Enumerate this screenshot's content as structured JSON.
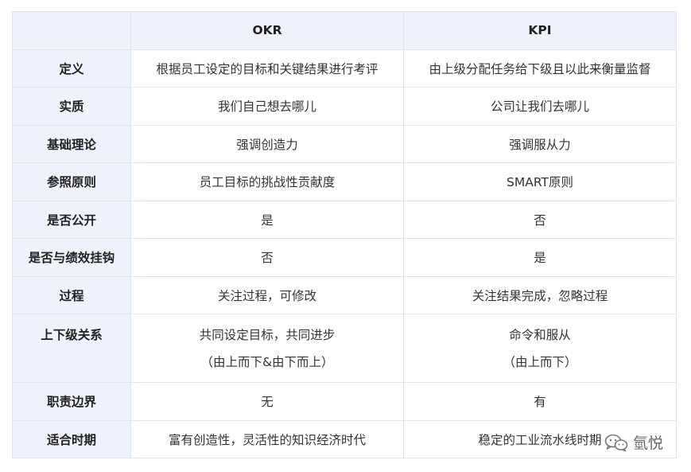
{
  "table": {
    "headers": [
      "",
      "OKR",
      "KPI"
    ],
    "rows": [
      {
        "label": "定义",
        "okr": "根据员工设定的目标和关键结果进行考评",
        "kpi": "由上级分配任务给下级且以此来衡量监督"
      },
      {
        "label": "实质",
        "okr": "我们自己想去哪儿",
        "kpi": "公司让我们去哪儿"
      },
      {
        "label": "基础理论",
        "okr": "强调创造力",
        "kpi": "强调服从力"
      },
      {
        "label": "参照原则",
        "okr": "员工目标的挑战性贡献度",
        "kpi": "SMART原则"
      },
      {
        "label": "是否公开",
        "okr": "是",
        "kpi": "否"
      },
      {
        "label": "是否与绩效挂钩",
        "okr": "否",
        "kpi": "是"
      },
      {
        "label": "过程",
        "okr": "关注过程，可修改",
        "kpi": "关注结果完成，忽略过程"
      },
      {
        "label": "上下级关系",
        "okr": "共同设定目标，共同进步",
        "okr2": "（由上而下&由下而上）",
        "kpi": "命令和服从",
        "kpi2": "（由上而下）"
      },
      {
        "label": "职责边界",
        "okr": "无",
        "kpi": "有"
      },
      {
        "label": "适合时期",
        "okr": "富有创造性，灵活性的知识经济时代",
        "kpi": "稳定的工业流水线时期"
      }
    ]
  },
  "watermark": {
    "icon": "wechat-icon",
    "text": "氫悦"
  }
}
